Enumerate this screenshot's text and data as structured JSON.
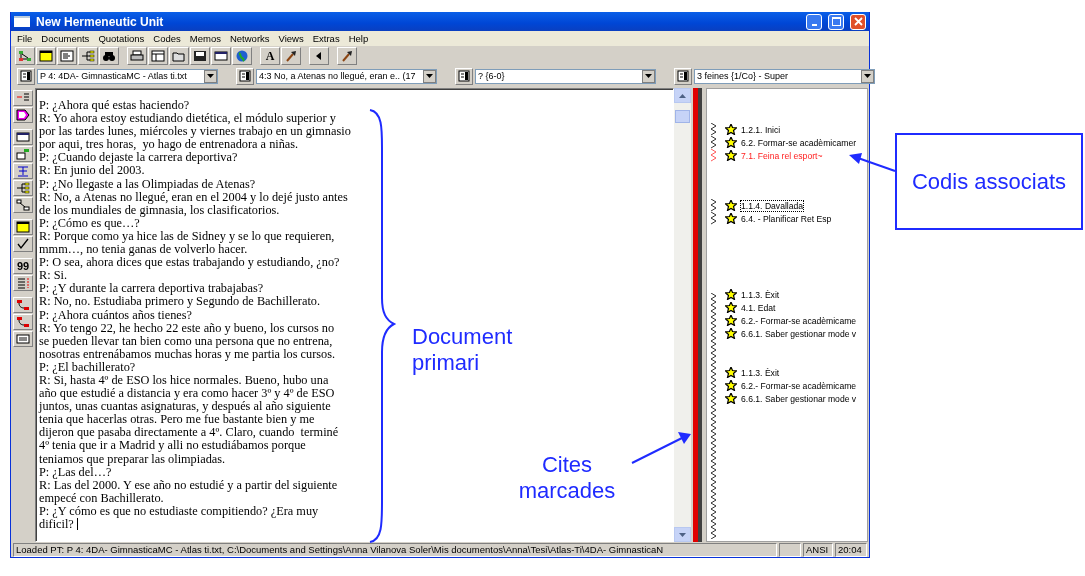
{
  "window": {
    "title": "New Hermeneutic Unit"
  },
  "menu": [
    "File",
    "Documents",
    "Quotations",
    "Codes",
    "Memos",
    "Networks",
    "Views",
    "Extras",
    "Help"
  ],
  "toolbar": [
    {
      "kind": "network"
    },
    {
      "kind": "yellow-window"
    },
    {
      "kind": "new-code"
    },
    {
      "kind": "code-tree"
    },
    {
      "kind": "binoculars"
    },
    {
      "kind": "gap"
    },
    {
      "kind": "printer"
    },
    {
      "kind": "table"
    },
    {
      "kind": "folder"
    },
    {
      "kind": "save"
    },
    {
      "kind": "window"
    },
    {
      "kind": "globe"
    },
    {
      "kind": "gap"
    },
    {
      "kind": "text",
      "label": "A"
    },
    {
      "kind": "hammer"
    },
    {
      "kind": "gap"
    },
    {
      "kind": "triangle"
    },
    {
      "kind": "gap"
    },
    {
      "kind": "hammer"
    }
  ],
  "selectors": [
    {
      "value": "P 4: 4DA- GimnasticaMC - Atlas ti.txt"
    },
    {
      "value": "4:3 No, a Atenas no llegué, eran e.. (17"
    },
    {
      "value": "? {6-0}"
    },
    {
      "value": "3 feines {1/Co} - Super"
    }
  ],
  "side_toolbar": [
    {
      "kind": "arrow-list"
    },
    {
      "kind": "tag"
    },
    {
      "kind": "gap"
    },
    {
      "kind": "window"
    },
    {
      "kind": "edit"
    },
    {
      "kind": "text-cursor"
    },
    {
      "kind": "code-tree"
    },
    {
      "kind": "link"
    },
    {
      "kind": "gap"
    },
    {
      "kind": "yellow-window"
    },
    {
      "kind": "check"
    },
    {
      "kind": "gap"
    },
    {
      "kind": "text",
      "label": "99"
    },
    {
      "kind": "list"
    },
    {
      "kind": "gap"
    },
    {
      "kind": "red-link"
    },
    {
      "kind": "red-link"
    },
    {
      "kind": "small-window"
    }
  ],
  "document": {
    "lines": [
      "P: ¿Ahora qué estas haciendo?",
      "R: Yo ahora estoy estudiando dietética, el módulo superior y",
      "por las tardes lunes, miércoles y viernes trabajo en un gimnasio",
      "por aqui, tres horas,  yo hago de entrenadora a niñas.",
      "P: ¿Cuando dejaste la carrera deportiva?",
      "R: En junio del 2003.",
      "P: ¿No llegaste a las Olimpiadas de Atenas?",
      "R: No, a Atenas no llegué, eran en el 2004 y lo dejé justo antes",
      "de los mundiales de gimnasia, los clasificatorios.",
      "P: ¿Cómo es que…?",
      "R: Porque como ya hice las de Sidney y se lo que requieren,",
      "mmm…, no tenia ganas de volverlo hacer.",
      "P: O sea, ahora dices que estas trabajando y estudiando, ¿no?",
      "R: Si.",
      "P: ¿Y durante la carrera deportiva trabajabas?",
      "R: No, no. Estudiaba primero y Segundo de Bachillerato.",
      "P: ¿Ahora cuántos años tienes?",
      "R: Yo tengo 22, he hecho 22 este año y bueno, los cursos no",
      "se pueden llevar tan bien como una persona que no entrena,",
      "nosotras entrenábamos muchas horas y me partia los cursos.",
      "P: ¿El bachillerato?",
      "R: Si, hasta 4º de ESO los hice normales. Bueno, hubo una",
      "año que estudié a distancia y era como hacer 3º y 4º de ESO",
      "juntos, unas cuantas asignaturas, y después al año siguiente",
      "tenia que hacerlas otras. Pero me fue bastante bien y me",
      "dijeron que pasaba directamente a 4º. Claro, cuando  terminé",
      "4º tenia que ir a Madrid y alli no estudiábamos porque",
      "teniamos que preparar las olimpiadas.",
      "P: ¿Las del…?",
      "R: Las del 2000. Y ese año no estudié y a partir del siguiente",
      "empecé con Bachillerato.",
      "P: ¿Y cómo es que no estudiaste compitiendo? ¿Era muy",
      "dificil?"
    ]
  },
  "margin": {
    "groups": [
      {
        "codes": [
          {
            "label": "1.2.1. Inici",
            "highlighted": false,
            "focused": false
          },
          {
            "label": "6.2. Formar-se acadèmicamer",
            "highlighted": false,
            "focused": false
          },
          {
            "label": "7.1. Feina rel esport~",
            "highlighted": true,
            "focused": false
          }
        ]
      },
      {
        "codes": [
          {
            "label": "1.1.4. Davallada",
            "highlighted": false,
            "focused": true
          },
          {
            "label": "6.4. - Planificar Ret Esp",
            "highlighted": false,
            "focused": false
          }
        ]
      },
      {
        "codes": [
          {
            "label": "1.1.3. Èxit",
            "highlighted": false,
            "focused": false
          },
          {
            "label": "4.1. Edat",
            "highlighted": false,
            "focused": false
          },
          {
            "label": "6.2.- Formar-se acadèmicame",
            "highlighted": false,
            "focused": false
          },
          {
            "label": "6.6.1. Saber gestionar mode v",
            "highlighted": false,
            "focused": false
          }
        ]
      },
      {
        "codes": [
          {
            "label": "1.1.3. Èxit",
            "highlighted": false,
            "focused": false
          },
          {
            "label": "6.2.- Formar-se acadèmicame",
            "highlighted": false,
            "focused": false
          },
          {
            "label": "6.6.1. Saber gestionar mode v",
            "highlighted": false,
            "focused": false
          }
        ]
      }
    ]
  },
  "status_bar": {
    "message": "Loaded PT: P 4: 4DA- GimnasticaMC - Atlas ti.txt, C:\\Documents and Settings\\Anna Vilanova Soler\\Mis documentos\\Anna\\Tesi\\Atlas-Ti\\4DA- GimnasticaN",
    "encoding": "ANSI",
    "time": "20:04"
  },
  "annotations": [
    {
      "kind": "brace",
      "text": "Document primari"
    },
    {
      "kind": "arrow",
      "text": "Cites marcades"
    },
    {
      "kind": "box",
      "text": "Codis associats"
    }
  ]
}
